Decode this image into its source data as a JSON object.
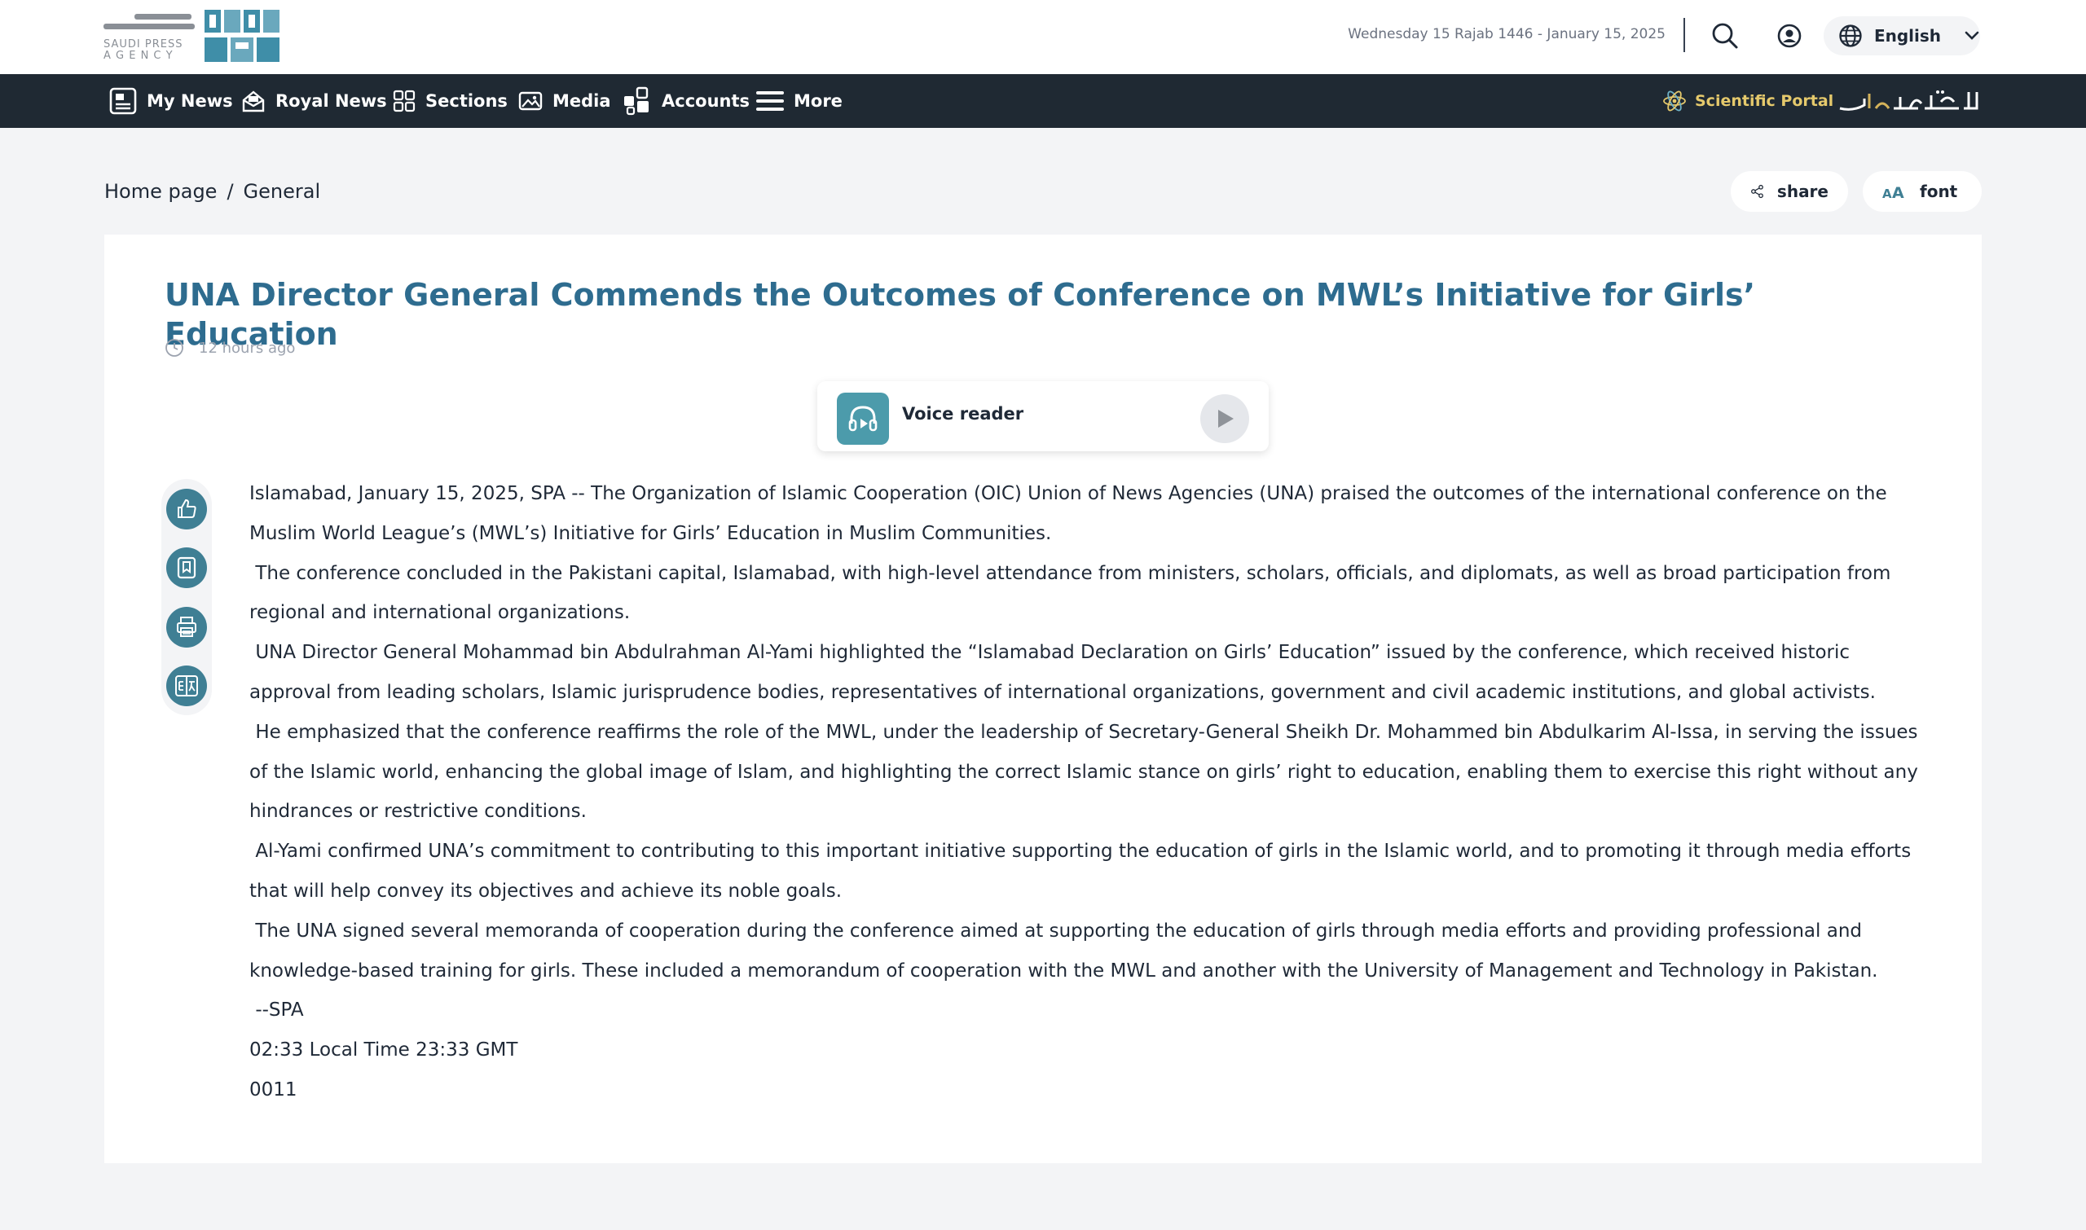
{
  "header": {
    "logo_en_line1": "SAUDI PRESS",
    "logo_en_line2": "A G E N C Y",
    "date": "Wednesday 15 Rajab 1446 - January 15, 2025",
    "language": "English"
  },
  "nav": {
    "items": [
      {
        "label": "My News",
        "icon": "my-news-icon"
      },
      {
        "label": "Royal News",
        "icon": "royal-news-icon"
      },
      {
        "label": "Sections",
        "icon": "sections-grid-icon"
      },
      {
        "label": "Media",
        "icon": "media-image-icon"
      },
      {
        "label": "Accounts",
        "icon": "accounts-icon"
      },
      {
        "label": "More",
        "icon": "menu-icon"
      }
    ],
    "portal_label": "Scientific Portal"
  },
  "breadcrumb": {
    "home": "Home page",
    "separator": "/",
    "current": "General"
  },
  "tools": {
    "share_label": "share",
    "font_label": "font"
  },
  "article": {
    "title": "UNA Director General Commends the Outcomes of Conference on MWL’s Initiative for Girls’ Education",
    "time_ago": "12 hours ago",
    "voice_reader_label": "Voice reader",
    "paragraphs": [
      "Islamabad, January 15, 2025, SPA -- The Organization of Islamic Cooperation (OIC) Union of News Agencies (UNA) praised the outcomes of the international conference on the Muslim World League’s (MWL’s) Initiative for Girls’ Education in Muslim Communities.",
      " The conference concluded in the Pakistani capital, Islamabad, with high-level attendance from ministers, scholars, officials, and diplomats, as well as broad participation from regional and international organizations.",
      " UNA Director General Mohammad bin Abdulrahman Al-Yami highlighted the “Islamabad Declaration on Girls’ Education” issued by the conference, which received historic approval from leading scholars, Islamic jurisprudence bodies, representatives of international organizations, government and civil academic institutions, and global activists.",
      " He emphasized that the conference reaffirms the role of the MWL, under the leadership of Secretary-General Sheikh Dr. Mohammed bin Abdulkarim Al-Issa, in serving the issues of the Islamic world, enhancing the global image of Islam, and highlighting the correct Islamic stance on girls’ right to education, enabling them to exercise this right without any hindrances or restrictive conditions.",
      " Al-Yami confirmed UNA’s commitment to contributing to this important initiative supporting the education of girls in the Islamic world, and to promoting it through media efforts that will help convey its objectives and achieve its noble goals.",
      " The UNA signed several memoranda of cooperation during the conference aimed at supporting the education of girls through media efforts and providing professional and knowledge-based training for girls. These included a memorandum of cooperation with the MWL and another with the University of Management and Technology in Pakistan.",
      " --SPA",
      "02:33 Local Time 23:33 GMT",
      "0011"
    ]
  },
  "colors": {
    "nav_bg": "#1f2933",
    "title": "#2e6c8f",
    "accent": "#3f7f94",
    "portal": "#e5c96c"
  }
}
